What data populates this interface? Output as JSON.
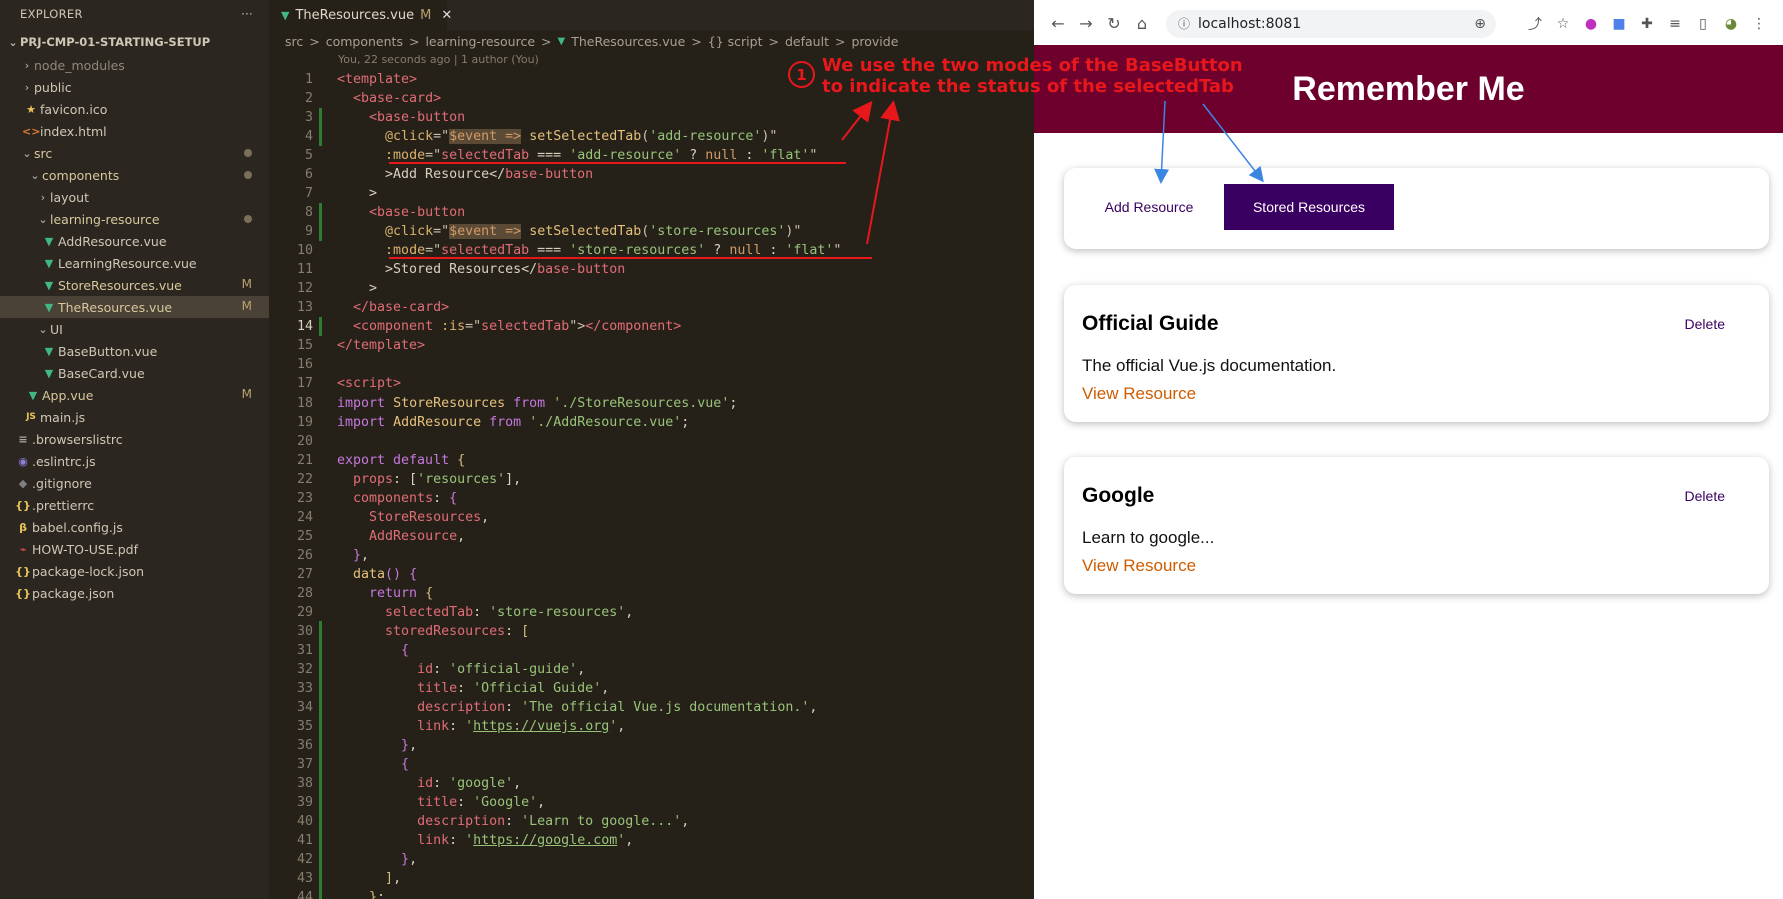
{
  "explorer": {
    "title": "EXPLORER",
    "more": "···",
    "project": "PRJ-CMP-01-STARTING-SETUP",
    "items": [
      {
        "label": "node_modules",
        "name": "folder-node-modules"
      },
      {
        "label": "public",
        "name": "folder-public"
      },
      {
        "label": "favicon.ico",
        "name": "file-favicon"
      },
      {
        "label": "index.html",
        "name": "file-index-html"
      },
      {
        "label": "src",
        "name": "folder-src"
      },
      {
        "label": "components",
        "name": "folder-components"
      },
      {
        "label": "layout",
        "name": "folder-layout"
      },
      {
        "label": "learning-resource",
        "name": "folder-learning-resource"
      },
      {
        "label": "AddResource.vue",
        "name": "file-addresource"
      },
      {
        "label": "LearningResource.vue",
        "name": "file-learningresource"
      },
      {
        "label": "StoreResources.vue",
        "name": "file-storeresources",
        "badge": "M"
      },
      {
        "label": "TheResources.vue",
        "name": "file-theresources",
        "badge": "M"
      },
      {
        "label": "UI",
        "name": "folder-ui"
      },
      {
        "label": "BaseButton.vue",
        "name": "file-basebutton"
      },
      {
        "label": "BaseCard.vue",
        "name": "file-basecard"
      },
      {
        "label": "App.vue",
        "name": "file-app-vue",
        "badge": "M"
      },
      {
        "label": "main.js",
        "name": "file-main-js"
      },
      {
        "label": ".browserslistrc",
        "name": "file-browserslistrc"
      },
      {
        "label": ".eslintrc.js",
        "name": "file-eslintrc"
      },
      {
        "label": ".gitignore",
        "name": "file-gitignore"
      },
      {
        "label": ".prettierrc",
        "name": "file-prettierrc"
      },
      {
        "label": "babel.config.js",
        "name": "file-babel-config"
      },
      {
        "label": "HOW-TO-USE.pdf",
        "name": "file-how-to-use"
      },
      {
        "label": "package-lock.json",
        "name": "file-package-lock"
      },
      {
        "label": "package.json",
        "name": "file-package-json"
      }
    ]
  },
  "editor": {
    "tab_label": "TheResources.vue",
    "tab_modified": "M",
    "tab_close": "✕",
    "breadcrumbs": [
      "src",
      ">",
      "components",
      ">",
      "learning-resource",
      ">",
      "TheResources.vue",
      ">",
      "{} script",
      ">",
      "default",
      ">",
      "provide"
    ],
    "blame": "You, 22 seconds ago | 1 author (You)"
  },
  "browser": {
    "url": "localhost:8081",
    "site_title": "Remember Me",
    "tabs": {
      "add": "Add Resource",
      "stored": "Stored Resources"
    },
    "resources": [
      {
        "title": "Official Guide",
        "description": "The official Vue.js documentation.",
        "link": "View Resource",
        "delete": "Delete"
      },
      {
        "title": "Google",
        "description": "Learn to google...",
        "link": "View Resource",
        "delete": "Delete"
      }
    ]
  },
  "annotation": {
    "number": "1",
    "line1": "We use the two modes of the BaseButton",
    "line2": "to indicate the status of the selectedTab"
  },
  "colors": {
    "header": "#6e002d",
    "primary": "#3a0061",
    "link": "#ce5c00",
    "annotation": "#e8171b"
  }
}
